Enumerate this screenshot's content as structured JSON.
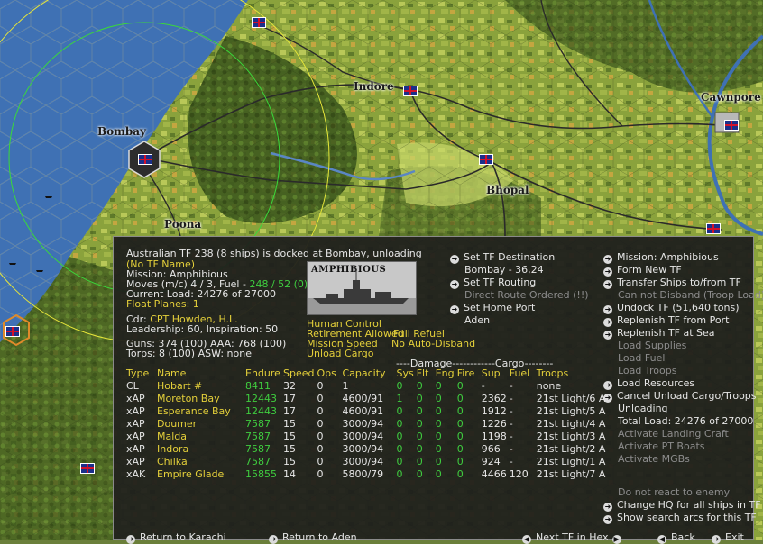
{
  "map": {
    "cities": [
      {
        "name": "Bombay"
      },
      {
        "name": "Indore"
      },
      {
        "name": "Bhopal"
      },
      {
        "name": "Poona"
      },
      {
        "name": "Cawnpore"
      }
    ]
  },
  "panel": {
    "header": "Australian TF 238 (8 ships) is docked at Bombay, unloading",
    "tf_name": "(No TF Name)",
    "mission": "Mission:  Amphibious",
    "moves_prefix": "Moves (m/c)  4 / 3, Fuel - ",
    "moves_fuel": "248 / 52 (0)",
    "current_load": "Current Load:  24276 of 27000",
    "float_planes": "Float Planes:  1",
    "cdr_prefix": "Cdr: ",
    "cdr_name": "CPT  Howden, H.L.",
    "leadership": "Leadership: 60, Inspiration: 50",
    "guns": "Guns: 374 (100) AAA: 768 (100)",
    "torps": "Torps: 8 (100)   ASW: none",
    "photo_title": "AMPHIBIOUS",
    "orders": {
      "human_control": "Human Control",
      "retirement": "Retirement Allowed",
      "full_refuel": "Full Refuel",
      "mission_speed": "Mission Speed",
      "no_auto_disband": "No Auto-Disband",
      "unload_cargo": "Unload Cargo"
    },
    "middle": {
      "set_destination": "Set TF Destination",
      "destination_value": "Bombay - 36,24",
      "set_routing": "Set TF Routing",
      "routing_value": "Direct Route Ordered (!!)",
      "set_home_port": "Set Home Port",
      "home_port_value": "Aden"
    },
    "right": {
      "mission": "Mission: Amphibious",
      "form_new_tf": "Form New TF",
      "transfer_ships": "Transfer Ships to/from TF",
      "cannot_disband": "Can not Disband (Troop Load)",
      "undock_tf": "Undock TF (51,640 tons)",
      "replenish_port": "Replenish TF from Port",
      "replenish_sea": "Replenish TF at Sea",
      "load_supplies": "Load Supplies",
      "load_fuel": "Load Fuel",
      "load_troops": "Load Troops",
      "load_resources": "Load Resources",
      "cancel_unload": "Cancel Unload Cargo/Troops",
      "unloading": "Unloading",
      "total_load": "Total Load: 24276 of 27000",
      "activate_landing_craft": "Activate Landing Craft",
      "activate_pt_boats": "Activate PT Boats",
      "activate_mgbs": "Activate MGBs",
      "do_not_react": "Do not react to enemy",
      "change_hq": "Change HQ for all ships in TF",
      "show_search_arcs": "Show search arcs for this TF"
    },
    "bottom": {
      "return_karachi": "Return to Karachi",
      "return_aden": "Return to Aden",
      "next_tf": "Next TF in Hex",
      "back": "Back",
      "exit": "Exit"
    },
    "table": {
      "damage_header": "----Damage------------Cargo--------",
      "columns": [
        "Type",
        "Name",
        "Endure",
        "Speed",
        "Ops",
        "Capacity",
        "Sys",
        "Flt",
        "Eng",
        "Fire",
        "Sup",
        "Fuel",
        "Troops"
      ],
      "rows": [
        {
          "type": "CL",
          "name": "Hobart #",
          "endure": "8411",
          "speed": "32",
          "ops": "0",
          "capacity": "1",
          "sys": "0",
          "flt": "0",
          "eng": "0",
          "fire": "0",
          "sup": "-",
          "fuel": "-",
          "troops": "none"
        },
        {
          "type": "xAP",
          "name": "Moreton Bay",
          "endure": "12443",
          "speed": "17",
          "ops": "0",
          "capacity": "4600/91",
          "sys": "1",
          "flt": "0",
          "eng": "0",
          "fire": "0",
          "sup": "2362",
          "fuel": "-",
          "troops": "21st Light/6 A"
        },
        {
          "type": "xAP",
          "name": "Esperance Bay",
          "endure": "12443",
          "speed": "17",
          "ops": "0",
          "capacity": "4600/91",
          "sys": "0",
          "flt": "0",
          "eng": "0",
          "fire": "0",
          "sup": "1912",
          "fuel": "-",
          "troops": "21st Light/5 A"
        },
        {
          "type": "xAP",
          "name": "Doumer",
          "endure": "7587",
          "speed": "15",
          "ops": "0",
          "capacity": "3000/94",
          "sys": "0",
          "flt": "0",
          "eng": "0",
          "fire": "0",
          "sup": "1226",
          "fuel": "-",
          "troops": "21st Light/4 A"
        },
        {
          "type": "xAP",
          "name": "Malda",
          "endure": "7587",
          "speed": "15",
          "ops": "0",
          "capacity": "3000/94",
          "sys": "0",
          "flt": "0",
          "eng": "0",
          "fire": "0",
          "sup": "1198",
          "fuel": "-",
          "troops": "21st Light/3 A"
        },
        {
          "type": "xAP",
          "name": "Indora",
          "endure": "7587",
          "speed": "15",
          "ops": "0",
          "capacity": "3000/94",
          "sys": "0",
          "flt": "0",
          "eng": "0",
          "fire": "0",
          "sup": "966",
          "fuel": "-",
          "troops": "21st Light/2 A"
        },
        {
          "type": "xAP",
          "name": "Chilka",
          "endure": "7587",
          "speed": "15",
          "ops": "0",
          "capacity": "3000/94",
          "sys": "0",
          "flt": "0",
          "eng": "0",
          "fire": "0",
          "sup": "924",
          "fuel": "-",
          "troops": "21st Light/1 A"
        },
        {
          "type": "xAK",
          "name": "Empire Glade",
          "endure": "15855",
          "speed": "14",
          "ops": "0",
          "capacity": "5800/79",
          "sys": "0",
          "flt": "0",
          "eng": "0",
          "fire": "0",
          "sup": "4466",
          "fuel": "120",
          "troops": "21st Light/7 A"
        }
      ]
    }
  }
}
